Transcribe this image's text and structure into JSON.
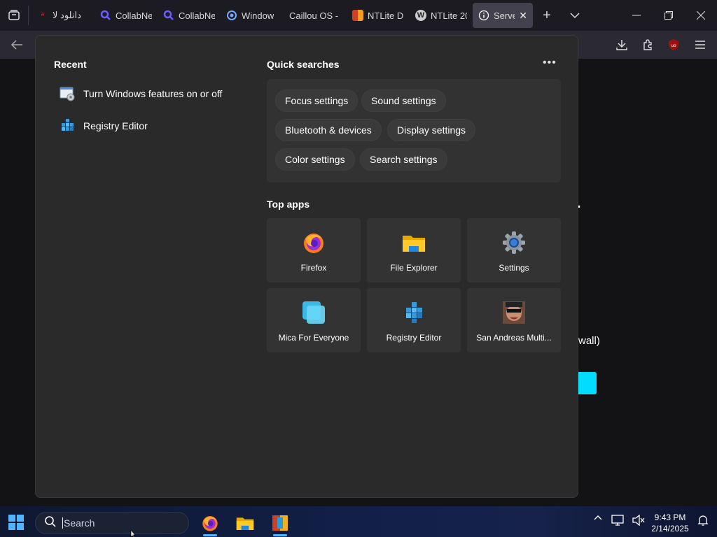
{
  "browser": {
    "tabs": [
      {
        "label": "دانلود لا",
        "icon": "red-logo-icon",
        "color": "#e0202a"
      },
      {
        "label": "CollabNe",
        "icon": "search-magnifier-icon",
        "color": "#6a5cff"
      },
      {
        "label": "CollabNe",
        "icon": "search-magnifier-icon",
        "color": "#6a5cff"
      },
      {
        "label": "Window",
        "icon": "circle-dot-icon",
        "color": "#7aa7ff"
      },
      {
        "label": "Caillou OS - ",
        "icon": "",
        "color": ""
      },
      {
        "label": "NTLite D",
        "icon": "ntlite-icon",
        "color": "#d04020"
      },
      {
        "label": "NTLite 20",
        "icon": "wordpress-icon",
        "color": "#cccccc"
      },
      {
        "label": "Server",
        "icon": "info-icon",
        "color": "#ffffff",
        "active": true
      }
    ]
  },
  "page": {
    "fragment_1": ".",
    "fragment_2": "wall)"
  },
  "start_menu": {
    "recent_title": "Recent",
    "recent": [
      {
        "label": "Turn Windows features on or off",
        "icon": "windows-features-icon"
      },
      {
        "label": "Registry Editor",
        "icon": "registry-editor-icon"
      }
    ],
    "quick_searches_title": "Quick searches",
    "more_label": "•••",
    "quick_searches": [
      "Focus settings",
      "Sound settings",
      "Bluetooth & devices",
      "Display settings",
      "Color settings",
      "Search settings"
    ],
    "top_apps_title": "Top apps",
    "top_apps": [
      {
        "label": "Firefox",
        "icon": "firefox-icon"
      },
      {
        "label": "File Explorer",
        "icon": "folder-icon"
      },
      {
        "label": "Settings",
        "icon": "gear-icon"
      },
      {
        "label": "Mica For Everyone",
        "icon": "mica-icon"
      },
      {
        "label": "Registry Editor",
        "icon": "registry-editor-icon"
      },
      {
        "label": "San Andreas Multi...",
        "icon": "samp-icon"
      }
    ]
  },
  "taskbar": {
    "search_placeholder": "Search",
    "time": "9:43 PM",
    "date": "2/14/2025",
    "accent": "#4fb5ff"
  }
}
